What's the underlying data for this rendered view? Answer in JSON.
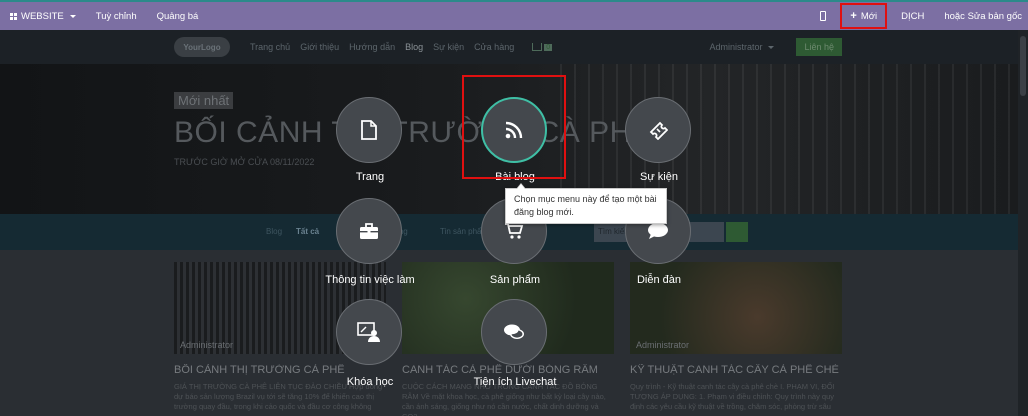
{
  "topbar": {
    "website_label": "WEBSITE",
    "customize_label": "Tuỳ chỉnh",
    "promote_label": "Quảng bá",
    "new_label": "Mới",
    "translate_label": "DỊCH",
    "edit_original_label": "hoặc Sửa bản gốc"
  },
  "sitenav": {
    "logo": "YourLogo",
    "links": [
      "Trang chủ",
      "Giới thiệu",
      "Hướng dẫn",
      "Blog",
      "Sự kiện",
      "Cửa hàng"
    ],
    "cart_count": "0",
    "user": "Administrator",
    "contact_label": "Liên hệ"
  },
  "hero": {
    "badge": "Mới nhất",
    "title": "BỐI CẢNH THỊ TRƯỜNG CÀ PHÊ",
    "subtitle": "TRƯỚC GIỜ MỞ CỬA 08/11/2022"
  },
  "blogbar": {
    "blog": "Blog",
    "all": "Tất cả",
    "tag1": "Thị trường",
    "tag2": "Tin sản phẩm",
    "search_placeholder": "Tìm kiếm"
  },
  "cards": [
    {
      "author": "Administrator",
      "title": "BỐI CẢNH THỊ TRƯỜNG CÀ PHÊ",
      "text": "GIÁ THỊ TRƯỜNG CÀ PHÊ LIÊN TỤC ĐẢO CHIỀU Hợp đồng dự báo sản lượng Brazil vụ tới sẽ tăng 10% để khiến cao thị trường quay đầu, trong khi cảo quốc và đầu cơ công không"
    },
    {
      "author": "",
      "title": "CANH TÁC CÀ PHÊ DƯỚI BÓNG RÂM",
      "text": "CUỘC CÁCH MẠNG NHỎ TRONG CANH TÁC ĐỒ BÓNG RÂM Về mặt khoa học, cà phê giống như bất kỳ loại cây nào, cần ánh sáng, giống như nó cần nước, chất dinh dưỡng và CO2"
    },
    {
      "author": "Administrator",
      "title": "KỸ THUẬT CANH TÁC CÂY CÀ PHÊ CHÈ",
      "text": "Quy trình - Kỹ thuật canh tác cây cà phê chè I. PHẠM VI, ĐỐI TƯỢNG ÁP DỤNG: 1. Phạm vi điều chỉnh: Quy trình này quy định các yêu cầu kỹ thuật về trồng, chăm sóc, phòng trừ sâu"
    }
  ],
  "dialog": {
    "options": [
      {
        "label": "Trang",
        "icon": "file-icon"
      },
      {
        "label": "Bài blog",
        "icon": "rss-icon",
        "active": true
      },
      {
        "label": "Sự kiện",
        "icon": "ticket-icon"
      },
      {
        "label": "Thông tin việc làm",
        "icon": "briefcase-icon"
      },
      {
        "label": "Sản phẩm",
        "icon": "cart-icon"
      },
      {
        "label": "Diễn đàn",
        "icon": "comment-icon"
      },
      {
        "label": "Khóa học",
        "icon": "course-icon"
      },
      {
        "label": "Tiện ích Livechat",
        "icon": "comments-icon"
      }
    ],
    "tooltip": "Chọn mục menu này để tạo một bài đăng blog mới."
  },
  "colors": {
    "topbar": "#7c6fa3",
    "highlight": "#e01010",
    "active_ring": "#3fbfa5"
  }
}
